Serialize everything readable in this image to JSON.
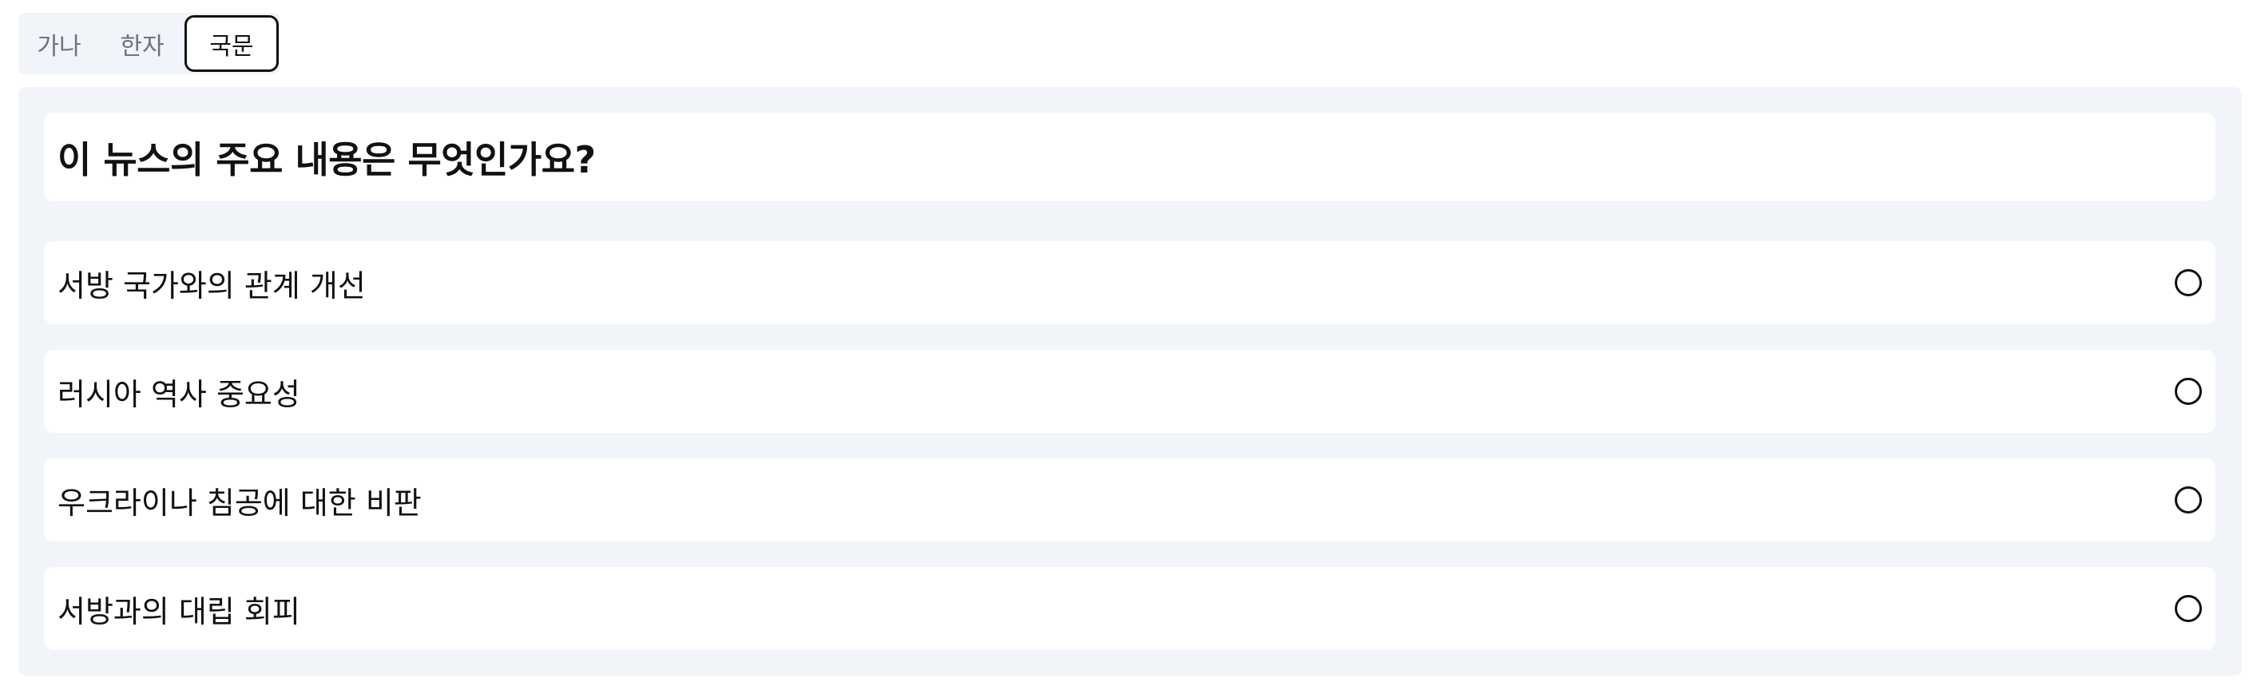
{
  "tabs": [
    {
      "label": "가나",
      "active": false
    },
    {
      "label": "한자",
      "active": false
    },
    {
      "label": "국문",
      "active": true
    }
  ],
  "question": {
    "text": "이 뉴스의 주요 내용은 무엇인가요?"
  },
  "options": [
    {
      "label": "서방 국가와의 관계 개선",
      "selected": false
    },
    {
      "label": "러시아 역사 중요성",
      "selected": false
    },
    {
      "label": "우크라이나 침공에 대한 비판",
      "selected": false
    },
    {
      "label": "서방과의 대립 회피",
      "selected": false
    }
  ],
  "colors": {
    "panel_background": "#f1f4f8",
    "card_background": "#ffffff",
    "text": "#111111",
    "inactive_tab_text": "#6b7280"
  }
}
